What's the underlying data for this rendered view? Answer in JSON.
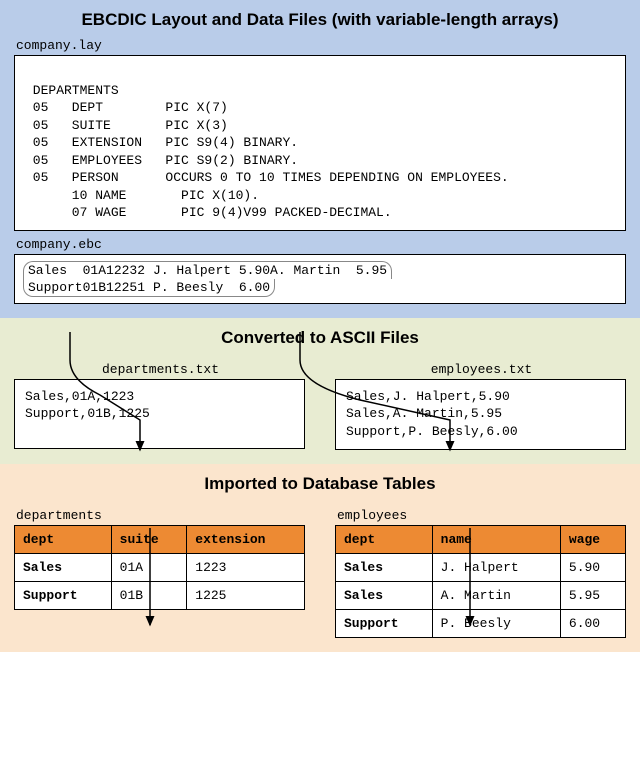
{
  "section1": {
    "title": "EBCDIC Layout and Data Files (with variable-length arrays)",
    "layout_file": {
      "name": "company.lay",
      "content": "\n DEPARTMENTS\n 05   DEPT        PIC X(7)\n 05   SUITE       PIC X(3)\n 05   EXTENSION   PIC S9(4) BINARY.\n 05   EMPLOYEES   PIC S9(2) BINARY.\n 05   PERSON      OCCURS 0 TO 10 TIMES DEPENDING ON EMPLOYEES.\n      10 NAME       PIC X(10).\n      07 WAGE       PIC 9(4)V99 PACKED-DECIMAL.\n"
    },
    "data_file": {
      "name": "company.ebc",
      "rows": [
        {
          "left": "Sales  01A12232",
          "right": "J. Halpert 5.90A. Martin  5.95"
        },
        {
          "left": "Support01B12251",
          "right": "P. Beesly  6.00"
        }
      ]
    }
  },
  "section2": {
    "title": "Converted to ASCII Files",
    "left": {
      "name": "departments.txt",
      "content": "Sales,01A,1223\nSupport,01B,1225"
    },
    "right": {
      "name": "employees.txt",
      "content": "Sales,J. Halpert,5.90\nSales,A. Martin,5.95\nSupport,P. Beesly,6.00"
    }
  },
  "section3": {
    "title": "Imported to Database Tables",
    "left": {
      "name": "departments",
      "headers": [
        "dept",
        "suite",
        "extension"
      ],
      "rows": [
        [
          "Sales",
          "01A",
          "1223"
        ],
        [
          "Support",
          "01B",
          "1225"
        ]
      ]
    },
    "right": {
      "name": "employees",
      "headers": [
        "dept",
        "name",
        "wage"
      ],
      "rows": [
        [
          "Sales",
          "J. Halpert",
          "5.90"
        ],
        [
          "Sales",
          "A. Martin",
          "5.95"
        ],
        [
          "Support",
          "P. Beesly",
          "6.00"
        ]
      ]
    }
  }
}
